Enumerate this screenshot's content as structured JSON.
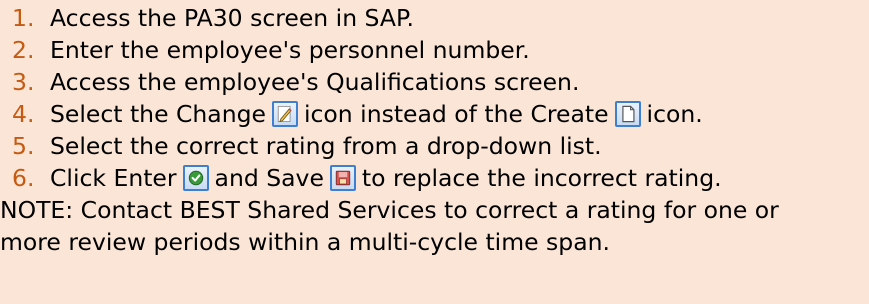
{
  "steps": [
    {
      "num": "1.",
      "text": "Access the PA30 screen in SAP."
    },
    {
      "num": "2.",
      "text": "Enter the employee's personnel number."
    },
    {
      "num": "3.",
      "text": "Access the employee's Qualifications screen."
    },
    {
      "num": "4.",
      "text_a": "Select the Change",
      "text_b": "icon instead of the Create",
      "text_c": "icon.",
      "icon_1": "change-pencil-icon",
      "icon_2": "create-document-icon"
    },
    {
      "num": "5.",
      "text": "Select the correct rating from a drop-down list."
    },
    {
      "num": "6.",
      "text_a": "Click Enter",
      "text_b": "and Save",
      "text_c": "to replace the incorrect rating.",
      "icon_1": "enter-checkmark-icon",
      "icon_2": "save-floppy-icon"
    }
  ],
  "note": {
    "line1": "NOTE: Contact BEST Shared Services to correct a rating for one or",
    "line2": "more review periods within a multi-cycle time span."
  },
  "colors": {
    "background": "#fbe5d6",
    "number": "#c55a11",
    "text": "#000000",
    "icon_border": "#3f7fd2"
  }
}
